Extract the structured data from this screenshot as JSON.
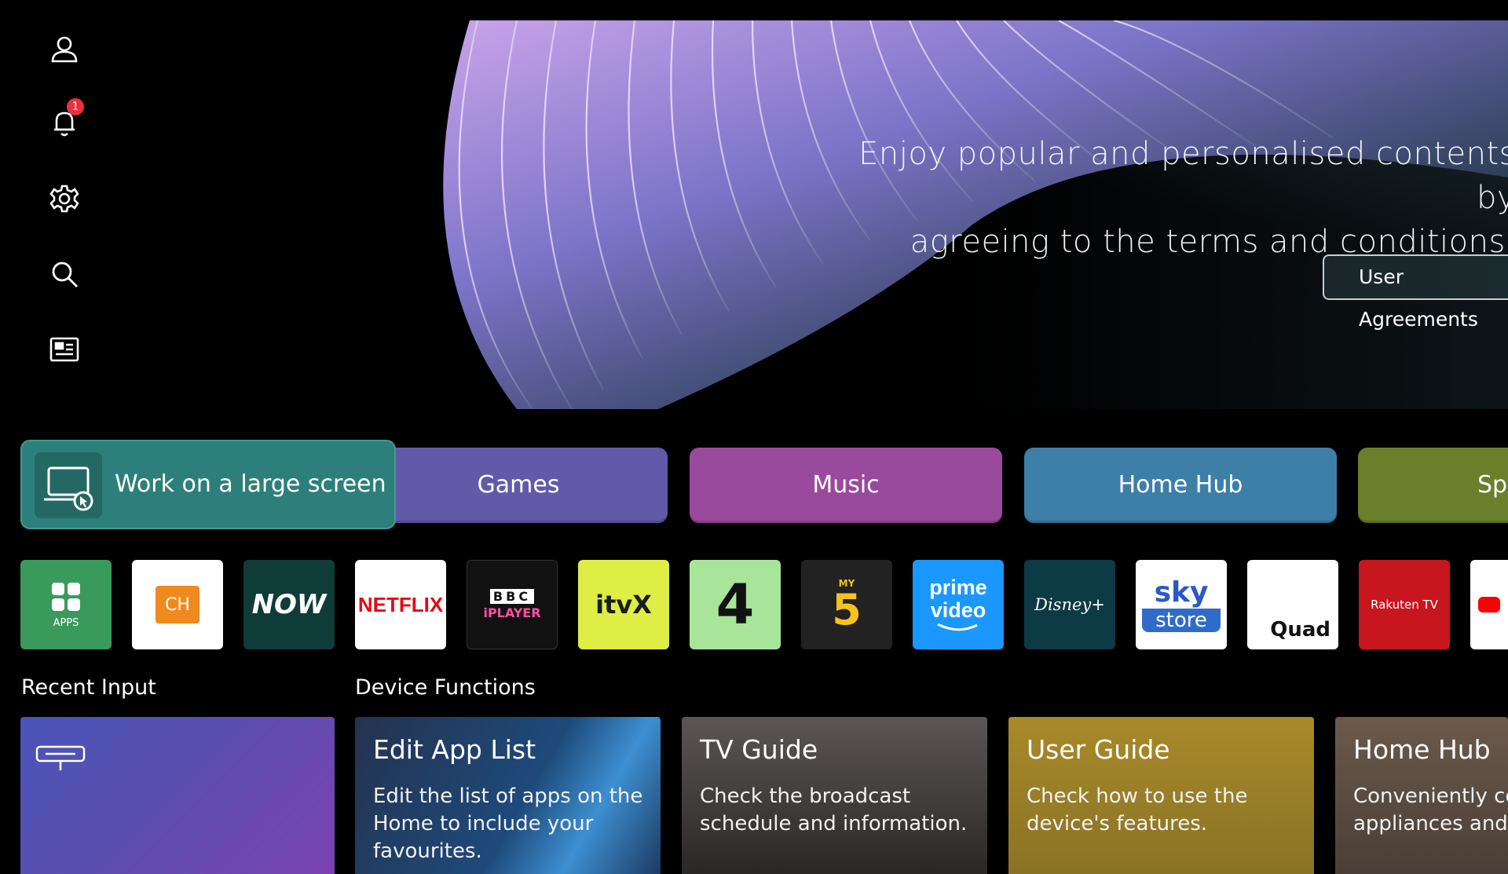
{
  "sidebar": {
    "icons": [
      "profile-icon",
      "notification-bell-icon",
      "settings-gear-icon",
      "search-icon",
      "guide-icon"
    ],
    "notification_count": "1"
  },
  "hero": {
    "line1": "Enjoy popular and personalised contents by",
    "line2": "agreeing to the terms and conditions.",
    "button_label": "User Agreements"
  },
  "categories": {
    "work": "Work on a large screen",
    "games": "Games",
    "music": "Music",
    "home_hub": "Home Hub",
    "sports": "Sports"
  },
  "category_colors": {
    "work": "#2d7f7b",
    "games": "#6259a8",
    "music": "#9a4a9c",
    "home_hub": "#3d7fa6",
    "sports": "#6b7f2b"
  },
  "apps": {
    "apps_label": "APPS",
    "ch_label": "CH",
    "now": "NOW",
    "netflix": "NETFLIX",
    "bbc": "BBC",
    "iplayer": "iPLAYER",
    "itvx": "itvX",
    "ch4": "4",
    "my5": "5",
    "my5_small": "MY",
    "prime1": "prime",
    "prime2": "video",
    "disney": "Disney+",
    "sky": "sky",
    "sky_store": "store",
    "quad": "Quad",
    "rakuten": "Rakuten TV",
    "youtube": "YouTube"
  },
  "sections": {
    "recent_input": "Recent Input",
    "device_functions": "Device Functions"
  },
  "cards": [
    {
      "title": "Edit App List",
      "desc": "Edit the list of apps on the Home to include your favourites."
    },
    {
      "title": "TV Guide",
      "desc": "Check the broadcast schedule and information."
    },
    {
      "title": "User Guide",
      "desc": "Check how to use the device's features."
    },
    {
      "title": "Home Hub",
      "desc": "Conveniently control home appliances and devices."
    }
  ]
}
